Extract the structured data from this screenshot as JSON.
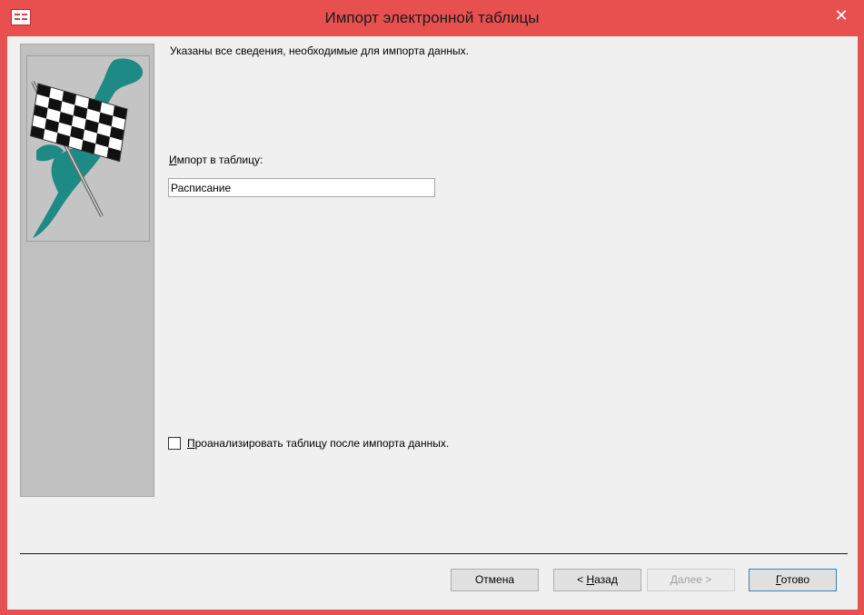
{
  "window": {
    "title": "Импорт электронной таблицы",
    "close_glyph": "✕"
  },
  "intro": {
    "text": "Указаны все сведения, необходимые для импорта данных."
  },
  "table_field": {
    "label_accesskey": "И",
    "label_rest": "мпорт в таблицу:",
    "value": "Расписание"
  },
  "analyze": {
    "checked": false,
    "label_accesskey": "П",
    "label_rest": "роанализировать таблицу после импорта данных."
  },
  "buttons": {
    "cancel": "Отмена",
    "back_prefix": "< ",
    "back_accesskey": "Н",
    "back_rest": "азад",
    "next_accesskey": "Д",
    "next_rest": "алее >",
    "finish_accesskey": "Г",
    "finish_rest": "отово"
  },
  "colors": {
    "title_bar": "#e85050",
    "client_bg": "#f0f0f0",
    "side_panel": "#c0c0c0",
    "flag_teal": "#1d8a86"
  },
  "icons": {
    "app": "access-form-icon",
    "close": "close-icon",
    "wizard_art": "checkered-flag-icon"
  }
}
